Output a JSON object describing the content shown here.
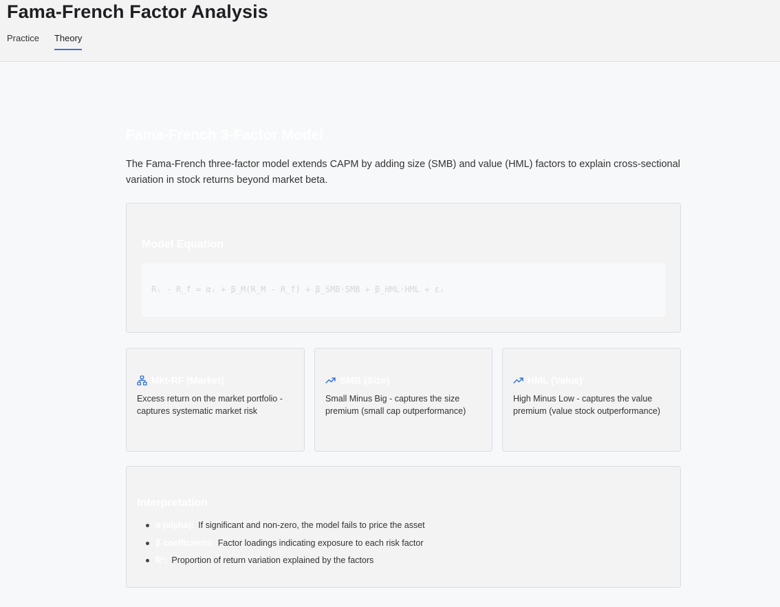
{
  "app": {
    "title": "Fama-French Factor Analysis",
    "tabs": [
      {
        "label": "Practice",
        "active": false
      },
      {
        "label": "Theory",
        "active": true
      }
    ]
  },
  "theory": {
    "section_title": "Fama-French 3-Factor Model",
    "intro": "The Fama-French three-factor model extends CAPM by adding size (SMB) and value (HML) factors to explain cross-sectional variation in stock returns beyond market beta.",
    "equation": {
      "title": "Model Equation",
      "formula": "Rᵢ - R_f = αᵢ + β_M(R_M - R_f) + β_SMB·SMB + β_HML·HML + εᵢ"
    },
    "factors": [
      {
        "icon": "network-icon",
        "title": "Mkt-RF (Market)",
        "description": "Excess return on the market portfolio - captures systematic market risk"
      },
      {
        "icon": "trending-up-icon",
        "title": "SMB (Size)",
        "description": "Small Minus Big - captures the size premium (small cap outperformance)"
      },
      {
        "icon": "trending-up-icon",
        "title": "HML (Value)",
        "description": "High Minus Low - captures the value premium (value stock outperformance)"
      }
    ],
    "interpretation": {
      "title": "Interpretation",
      "items": [
        {
          "term": "α (alpha):",
          "text": "If significant and non-zero, the model fails to price the asset"
        },
        {
          "term": "β coefficients:",
          "text": "Factor loadings indicating exposure to each risk factor"
        },
        {
          "term": "R²:",
          "text": "Proportion of return variation explained by the factors"
        }
      ]
    }
  },
  "colors": {
    "accent": "#3a6fd8",
    "icon": "#2f6fd6",
    "background": "#f7f8fa",
    "card": "#f3f3f4"
  }
}
